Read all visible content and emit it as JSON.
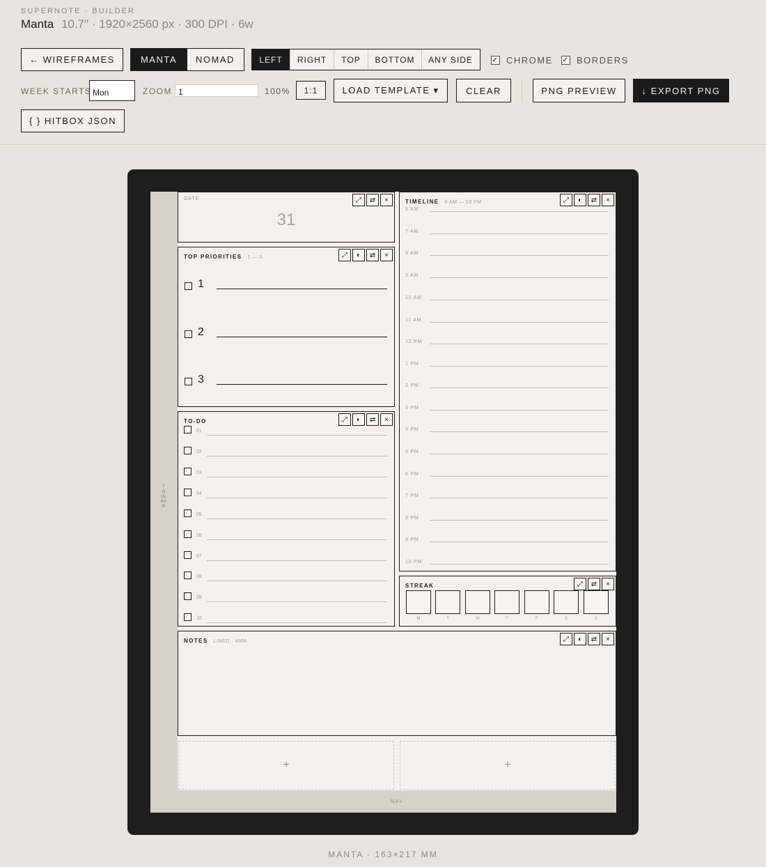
{
  "app": {
    "kicker": "SUPERNOTE · BUILDER",
    "model": "Manta",
    "spec": "10.7″ · 1920×2560 px · 300 DPI · 6w"
  },
  "toolbar": {
    "wireframes_label": "← WIREFRAMES",
    "devices": [
      "MANTA",
      "NOMAD"
    ],
    "active_device": "MANTA",
    "sides": [
      "LEFT",
      "RIGHT",
      "TOP",
      "BOTTOM",
      "ANY SIDE"
    ],
    "active_side": "LEFT",
    "chrome_label": "CHROME",
    "chrome_checked": true,
    "borders_label": "BORDERS",
    "borders_checked": true,
    "week_starts_label": "WEEK STARTS",
    "week_starts_value": "Mon",
    "zoom_label": "ZOOM",
    "zoom_value": "1",
    "zoom_percent": "100%",
    "one_to_one_label": "1:1",
    "load_template_label": "LOAD TEMPLATE ▾",
    "clear_label": "CLEAR",
    "png_preview_label": "PNG PREVIEW",
    "export_png_label": "↓ EXPORT PNG",
    "hitbox_json_label": "{ } HITBOX JSON"
  },
  "device": {
    "toolbar_label": "TOOLBAR",
    "nav_label": "NAV",
    "footer": "MANTA · 163×217 MM"
  },
  "widgets": {
    "icons": {
      "resize": "⤢",
      "contrast": "◐",
      "swap": "⇄",
      "close": "×"
    },
    "date": {
      "label": "DATE",
      "value": "31"
    },
    "priorities": {
      "title": "TOP PRIORITIES",
      "sub": "1 — 3",
      "items": [
        "1",
        "2",
        "3"
      ]
    },
    "todo": {
      "title": "TO-DO",
      "items": [
        "01",
        "02",
        "03",
        "04",
        "05",
        "06",
        "07",
        "08",
        "09",
        "10"
      ]
    },
    "timeline": {
      "title": "TIMELINE",
      "sub": "6 AM — 10 PM",
      "hours": [
        "6 AM",
        "7 AM",
        "8 AM",
        "9 AM",
        "10 AM",
        "11 AM",
        "12 PM",
        "1 PM",
        "2 PM",
        "3 PM",
        "4 PM",
        "5 PM",
        "6 PM",
        "7 PM",
        "8 PM",
        "9 PM",
        "10 PM"
      ]
    },
    "streak": {
      "title": "STREAK",
      "days": [
        "M",
        "T",
        "W",
        "T",
        "F",
        "S",
        "S"
      ]
    },
    "notes": {
      "title": "NOTES",
      "sub": "LINED · 4MM"
    },
    "add_slot": "+"
  }
}
